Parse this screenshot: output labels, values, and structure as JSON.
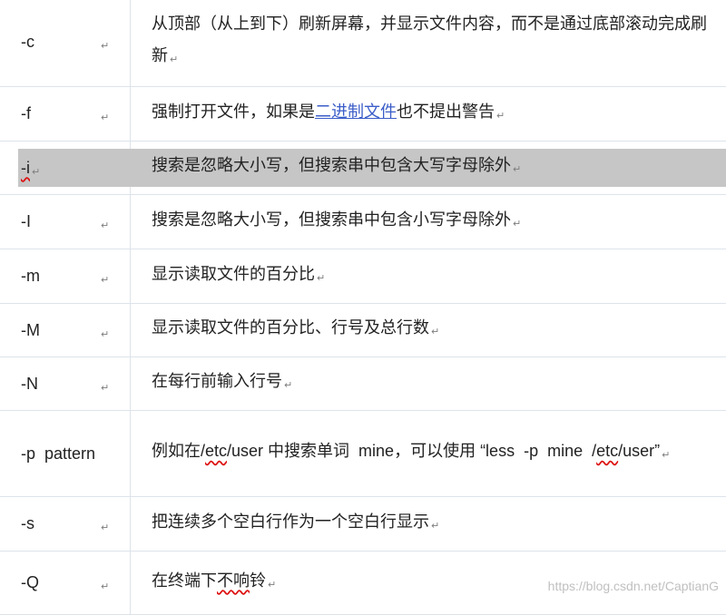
{
  "rows": [
    {
      "flag": "-c",
      "desc": "从顶部（从上到下）刷新屏幕，并显示文件内容，而不是通过底部滚动完成刷新"
    },
    {
      "flag": "-f",
      "desc_before": "强制打开文件，如果是",
      "desc_link": "二进制文件",
      "desc_after": "也不提出警告"
    },
    {
      "flag": "-i",
      "desc": "搜索是忽略大小写，但搜索串中包含大写字母除外"
    },
    {
      "flag": "-I",
      "desc": "搜索是忽略大小写，但搜索串中包含小写字母除外"
    },
    {
      "flag": "-m",
      "desc": "显示读取文件的百分比"
    },
    {
      "flag": "-M",
      "desc": "显示读取文件的百分比、行号及总行数"
    },
    {
      "flag": "-N",
      "desc": "在每行前输入行号"
    },
    {
      "flag": "-p  pattern",
      "desc_1": "例如在/",
      "desc_2": "etc",
      "desc_3": "/user 中搜索单词  mine，可以使用 “less  -p  mine  /",
      "desc_4": "etc",
      "desc_5": "/user”"
    },
    {
      "flag": "-s",
      "desc": "把连续多个空白行作为一个空白行显示"
    },
    {
      "flag": "-Q",
      "desc_1": "在终端下",
      "desc_2": "不响",
      "desc_3": "铃"
    }
  ],
  "paragraph_mark": "↵",
  "watermark": "https://blog.csdn.net/CaptianG"
}
